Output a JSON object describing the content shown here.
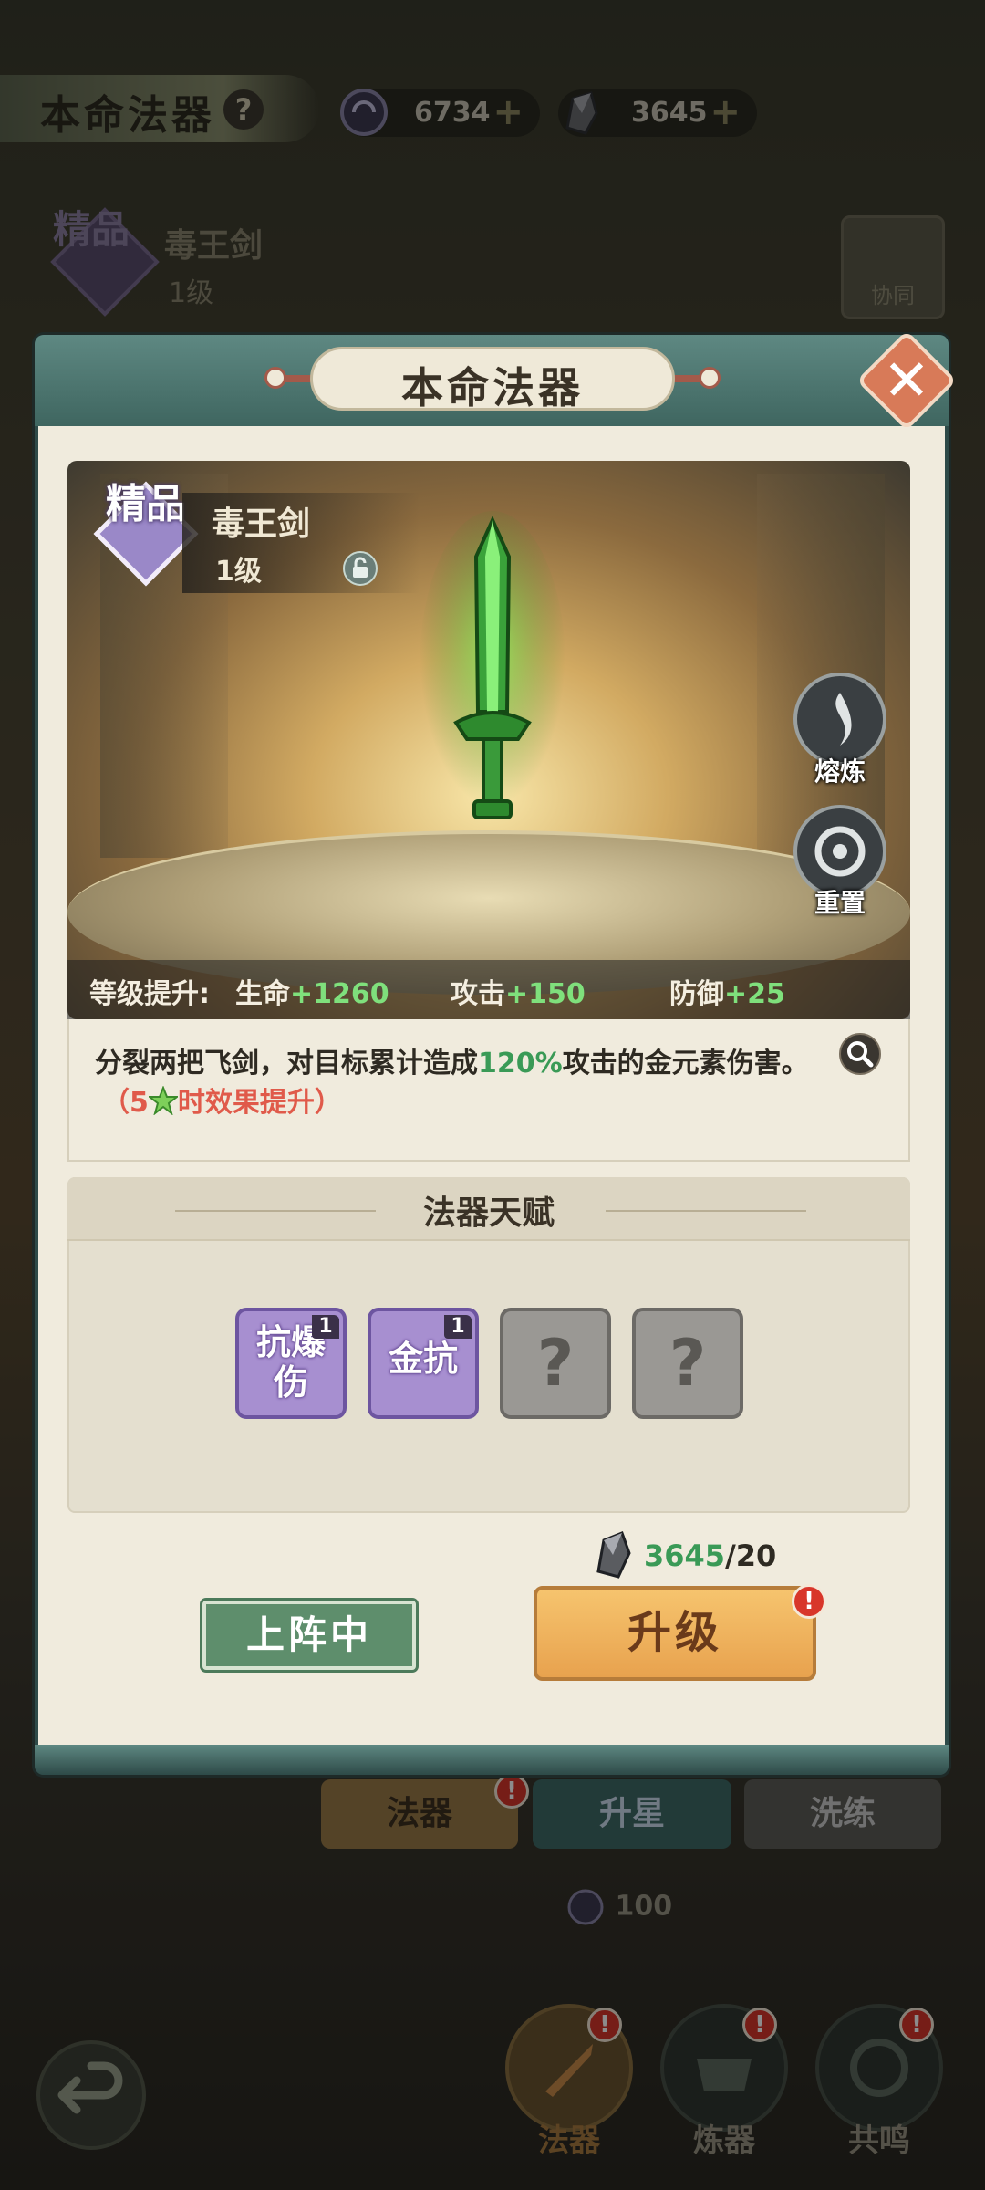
{
  "header": {
    "title": "本命法器",
    "help": "?",
    "resources": [
      {
        "icon": "spirit-coin-icon",
        "value": "6734",
        "plus": "+"
      },
      {
        "icon": "ore-stone-icon",
        "value": "3645",
        "plus": "+"
      }
    ]
  },
  "background_item": {
    "grade": "精品",
    "name": "毒王剑",
    "level": "1级",
    "coop_label": "协同"
  },
  "modal": {
    "title": "本命法器",
    "close": "✕",
    "item": {
      "grade": "精品",
      "name": "毒王剑",
      "level": "1级"
    },
    "side_buttons": [
      {
        "label": "熔炼"
      },
      {
        "label": "重置"
      }
    ],
    "stats": {
      "prefix": "等级提升:",
      "hp_label": "生命",
      "hp_value": "+1260",
      "atk_label": "攻击",
      "atk_value": "+150",
      "def_label": "防御",
      "def_value": "+25"
    },
    "description": {
      "part1": "分裂两把飞剑，对目标累计造成",
      "highlight": "120%",
      "part2": "攻击的金元素伤害。",
      "note_open": "（5",
      "note_close": "时效果提升）"
    },
    "talent": {
      "title": "法器天赋",
      "slots": [
        {
          "label": "抗爆伤",
          "line1": "抗爆",
          "line2": "伤",
          "count": "1",
          "locked": false
        },
        {
          "label": "金抗",
          "line1": "金抗",
          "line2": "",
          "count": "1",
          "locked": false
        },
        {
          "label": "?",
          "locked": true
        },
        {
          "label": "?",
          "locked": true
        }
      ]
    },
    "cost": {
      "have": "3645",
      "need": "/20"
    },
    "deploy_button": "上阵中",
    "upgrade_button": "升级",
    "badge": "!"
  },
  "bottom_tabs": {
    "sub_tabs": [
      "法器",
      "升星",
      "洗练"
    ],
    "sub_cost": "100",
    "main_tabs": [
      "法器",
      "炼器",
      "共鸣"
    ]
  },
  "colors": {
    "accent_green": "#3a9a56",
    "stat_green": "#7fe07c",
    "warn_red": "#e05a4a",
    "talent_purple": "#a78fd0",
    "frame_teal": "#3f6660"
  }
}
